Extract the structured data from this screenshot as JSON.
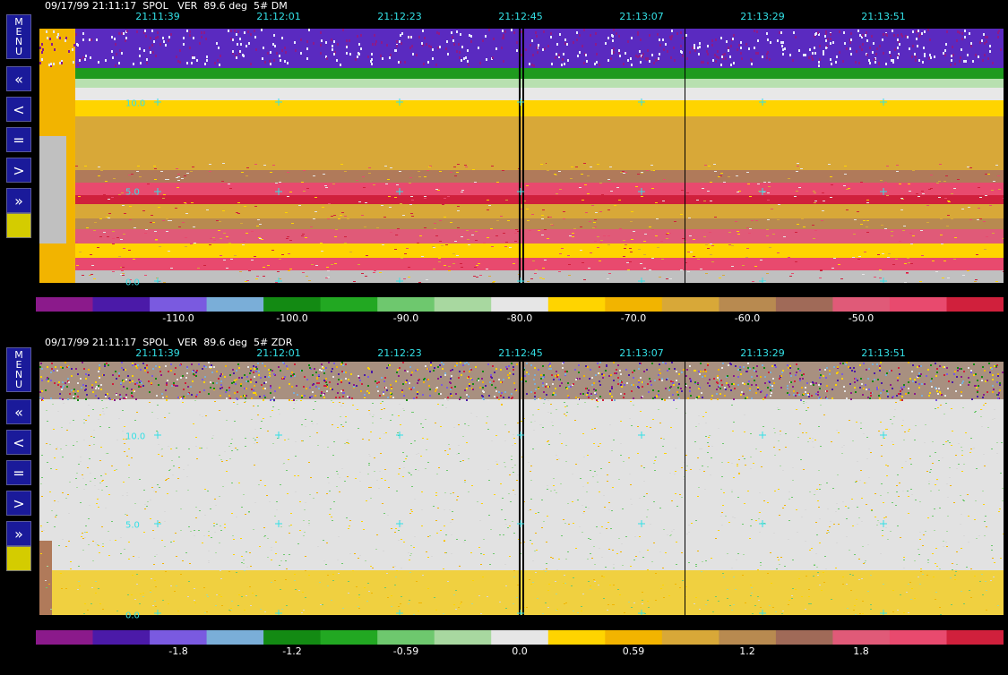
{
  "panels": [
    {
      "header": "09/17/99 21:11:17  SPOL   VER  89.6 deg  5# DM",
      "time_ticks": [
        "21:11:39",
        "21:12:01",
        "21:12:23",
        "21:12:45",
        "21:13:07",
        "21:13:29",
        "21:13:51"
      ],
      "y_labels": [
        "10.0",
        "5.0",
        "0.0"
      ],
      "colorbar_labels": [
        "-110.0",
        "-100.0",
        "-90.0",
        "-80.0",
        "-70.0",
        "-60.0",
        "-50.0"
      ],
      "field": "DM"
    },
    {
      "header": "09/17/99 21:11:17  SPOL   VER  89.6 deg  5# ZDR",
      "time_ticks": [
        "21:11:39",
        "21:12:01",
        "21:12:23",
        "21:12:45",
        "21:13:07",
        "21:13:29",
        "21:13:51"
      ],
      "y_labels": [
        "10.0",
        "5.0",
        "0.0"
      ],
      "colorbar_labels": [
        "-1.8",
        "-1.2",
        "-0.59",
        "0.0",
        "0.59",
        "1.2",
        "1.8"
      ],
      "field": "ZDR"
    }
  ],
  "side_buttons": {
    "menu": [
      "M",
      "E",
      "N",
      "U"
    ],
    "first": "«",
    "prev": "<",
    "center": "=",
    "next": ">",
    "last": "»"
  },
  "colors": {
    "palette": [
      "#8b1a8b",
      "#4b1aa8",
      "#7a5ae0",
      "#7aaed8",
      "#138a13",
      "#22a822",
      "#6ec86e",
      "#a8d8a0",
      "#e6e6e6",
      "#ffd400",
      "#f2b400",
      "#d8a838",
      "#b88a50",
      "#a06a58",
      "#e05a78",
      "#e84a6e",
      "#d0203c"
    ],
    "tick_text": "#33e0e6",
    "button_bg": "#1a1a9a",
    "indicator": "#d4cc00"
  }
}
